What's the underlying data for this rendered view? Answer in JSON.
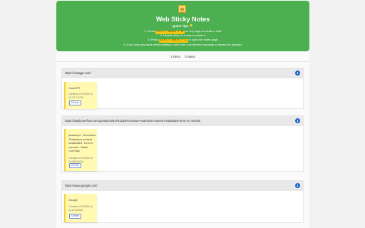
{
  "header": {
    "title": "Web Sticky Notes",
    "tips_title": "Quick Tips 💡",
    "tips": [
      {
        "before": "1. Press ",
        "key": "Ctrl + Shift + M",
        "after": " on any page to create a note"
      },
      {
        "before": "2. Double-click on a note to delete it",
        "key": "",
        "after": ""
      },
      {
        "before": "3. Press ",
        "key": "Ctrl + Shift + L",
        "after": " to open the notes page"
      },
      {
        "before": "4. If you face any issue while creating a new note, just refresh that page or restart the browser.",
        "key": "",
        "after": ""
      }
    ]
  },
  "stats": {
    "urls": "3 URLs",
    "notes": "3 Notes"
  },
  "groups": [
    {
      "url": "https://chatgpt.com/",
      "count": "1",
      "note": {
        "text": "ChatGPT",
        "created": "Created: 8/7/2025 at 12:32:13 PM",
        "delete_label": "Delete"
      }
    },
    {
      "url": "https://stackoverflow.com/questions/54761238/recursive-extension-context-invalidated-error-in-console",
      "count": "1",
      "note": {
        "text": "javascript - Recursive \"Extension context invalidated\" error in console - Stack Overflow",
        "created": "Created: 8/7/2025 at 12:08:08 PM",
        "delete_label": "Delete"
      }
    },
    {
      "url": "https://www.google.com/",
      "count": "1",
      "note": {
        "text": "Google",
        "created": "Created: 8/7/2025 at 11:22:38 AM",
        "delete_label": "Delete"
      }
    }
  ],
  "colors": {
    "header": "#4caf50",
    "key_highlight": "#f1c40f",
    "note_bg": "#fff9b1",
    "badge": "#1e63c9"
  }
}
